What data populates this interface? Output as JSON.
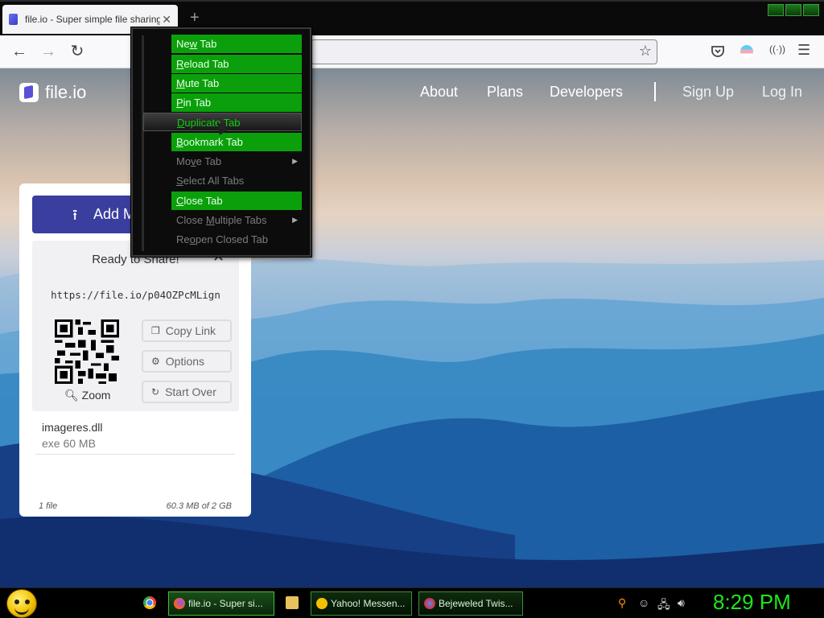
{
  "browser": {
    "tab_title": "file.io - Super simple file sharing",
    "tab_close": "✕",
    "new_tab": "+",
    "back": "←",
    "forward": "→",
    "reload": "↻",
    "star": "☆",
    "menu": "☰",
    "toolbar_icons": [
      "pocket-icon",
      "extension-flag-icon",
      "cast-icon",
      "hamburger-menu-icon"
    ]
  },
  "site": {
    "logo": "file.io",
    "nav": [
      "About",
      "Plans",
      "Developers"
    ],
    "sign_up": "Sign Up",
    "log_in": "Log In"
  },
  "card": {
    "add_button": "Add M",
    "ready_text": "Ready to Share!",
    "close": "✕",
    "link": "https://file.io/p04OZPcMLign",
    "zoom": "Zoom",
    "actions": [
      "Copy Link",
      "Options",
      "Start Over"
    ],
    "file_name": "imageres.dll",
    "file_meta": "exe 60 MB",
    "file_count": "1 file",
    "usage": "60.3 MB of 2 GB"
  },
  "context_menu": {
    "items": [
      {
        "label": "New Tab",
        "access": "w",
        "state": "enabled"
      },
      {
        "label": "Reload Tab",
        "access": "R",
        "state": "enabled"
      },
      {
        "label": "Mute Tab",
        "access": "M",
        "state": "enabled"
      },
      {
        "label": "Pin Tab",
        "access": "P",
        "state": "enabled"
      },
      {
        "label": "Duplicate Tab",
        "access": "D",
        "state": "hover"
      },
      {
        "label": "Bookmark Tab",
        "access": "B",
        "state": "enabled"
      },
      {
        "label": "Move Tab",
        "access": "v",
        "state": "disabled",
        "submenu": true
      },
      {
        "label": "Select All Tabs",
        "access": "S",
        "state": "disabled"
      },
      {
        "label": "Close Tab",
        "access": "C",
        "state": "enabled"
      },
      {
        "label": "Close Multiple Tabs",
        "access": "M",
        "state": "disabled",
        "submenu": true
      },
      {
        "label": "Reopen Closed Tab",
        "access": "o",
        "state": "disabled"
      }
    ]
  },
  "taskbar": {
    "tasks": [
      "file.io - Super si...",
      "Yahoo! Messen...",
      "Bejeweled Twis..."
    ],
    "clock": "8:29 PM"
  },
  "colors": {
    "menu_green": "#0ba00b",
    "menu_bg": "#0c0c0c",
    "brand_purple": "#3a3e9e",
    "clock_green": "#1ee61e"
  }
}
